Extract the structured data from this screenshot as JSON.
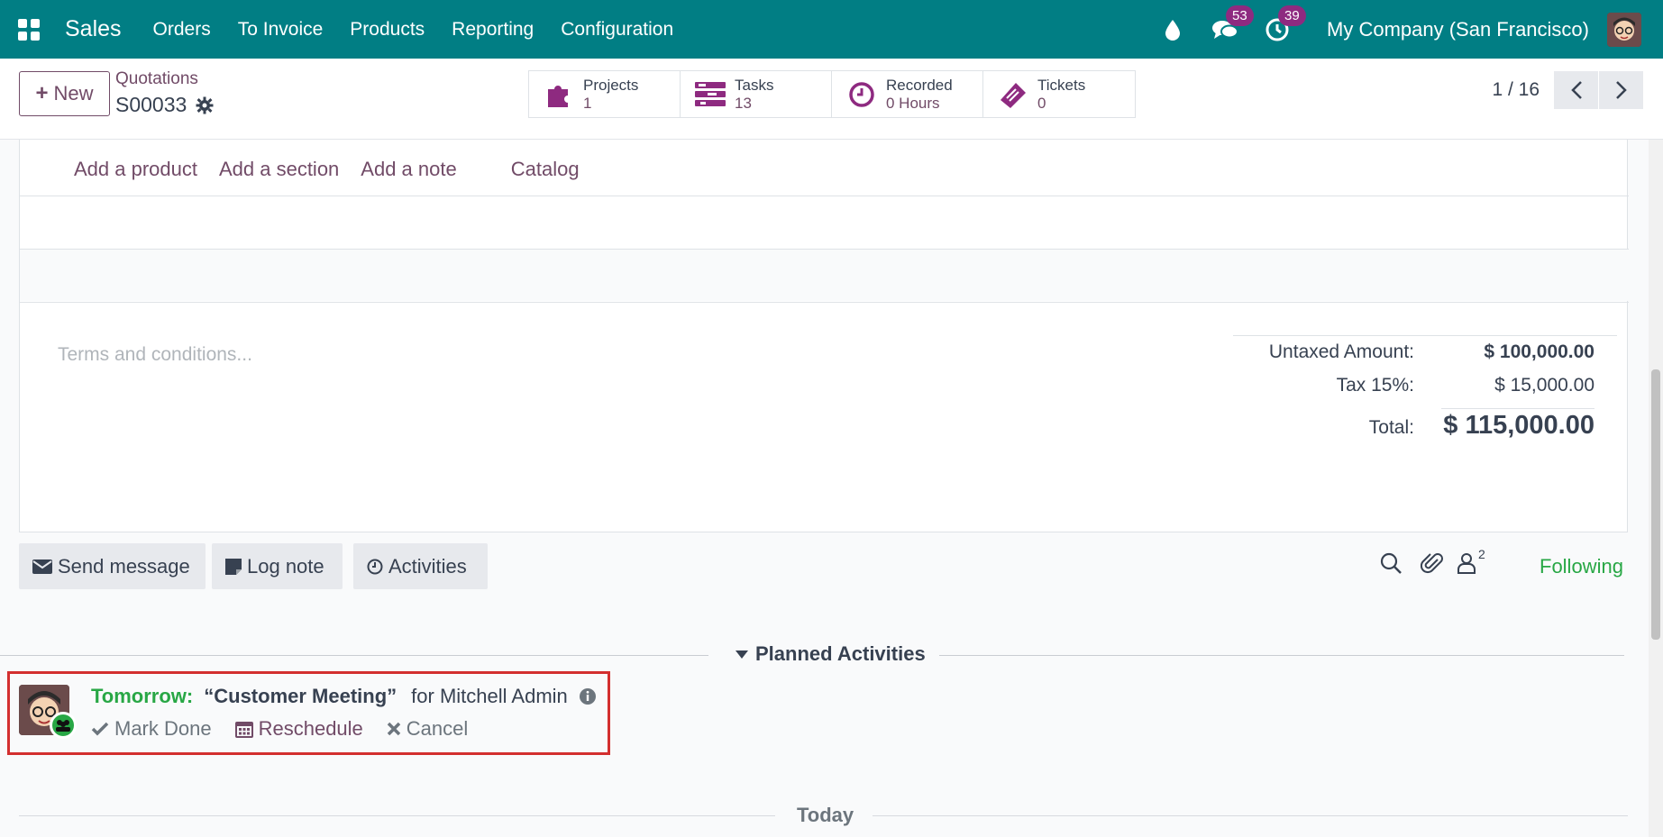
{
  "navbar": {
    "brand": "Sales",
    "menu": [
      "Orders",
      "To Invoice",
      "Products",
      "Reporting",
      "Configuration"
    ],
    "messages_count": "53",
    "activities_count": "39",
    "company": "My Company (San Francisco)"
  },
  "control": {
    "new_label": "New",
    "breadcrumb": "Quotations",
    "record_name": "S00033",
    "smart_buttons": [
      {
        "title": "Projects",
        "value": "1",
        "icon": "puzzle-icon"
      },
      {
        "title": "Tasks",
        "value": "13",
        "icon": "tasks-icon"
      },
      {
        "title": "Recorded",
        "value": "0 Hours",
        "icon": "clock-icon"
      },
      {
        "title": "Tickets",
        "value": "0",
        "icon": "ticket-icon"
      }
    ],
    "pager": "1 / 16"
  },
  "order_lines": {
    "add_product": "Add a product",
    "add_section": "Add a section",
    "add_note": "Add a note",
    "catalog": "Catalog"
  },
  "terms_placeholder": "Terms and conditions...",
  "totals": {
    "untaxed_label": "Untaxed Amount:",
    "untaxed_value": "$ 100,000.00",
    "tax_label": "Tax 15%:",
    "tax_value": "$ 15,000.00",
    "total_label": "Total:",
    "total_value": "$ 115,000.00"
  },
  "chatter": {
    "send_message": "Send message",
    "log_note": "Log note",
    "activities": "Activities",
    "followers_count": "2",
    "following": "Following",
    "planned_activities": "Planned Activities",
    "activity": {
      "when": "Tomorrow:",
      "summary": "“Customer Meeting”",
      "for": "for Mitchell Admin",
      "mark_done": "Mark Done",
      "reschedule": "Reschedule",
      "cancel": "Cancel"
    },
    "today": "Today"
  },
  "colors": {
    "navbar": "#017e84",
    "primary": "#714b67",
    "success": "#28a745",
    "badge": "#8e2a80",
    "highlight_border": "#d32f2f"
  }
}
